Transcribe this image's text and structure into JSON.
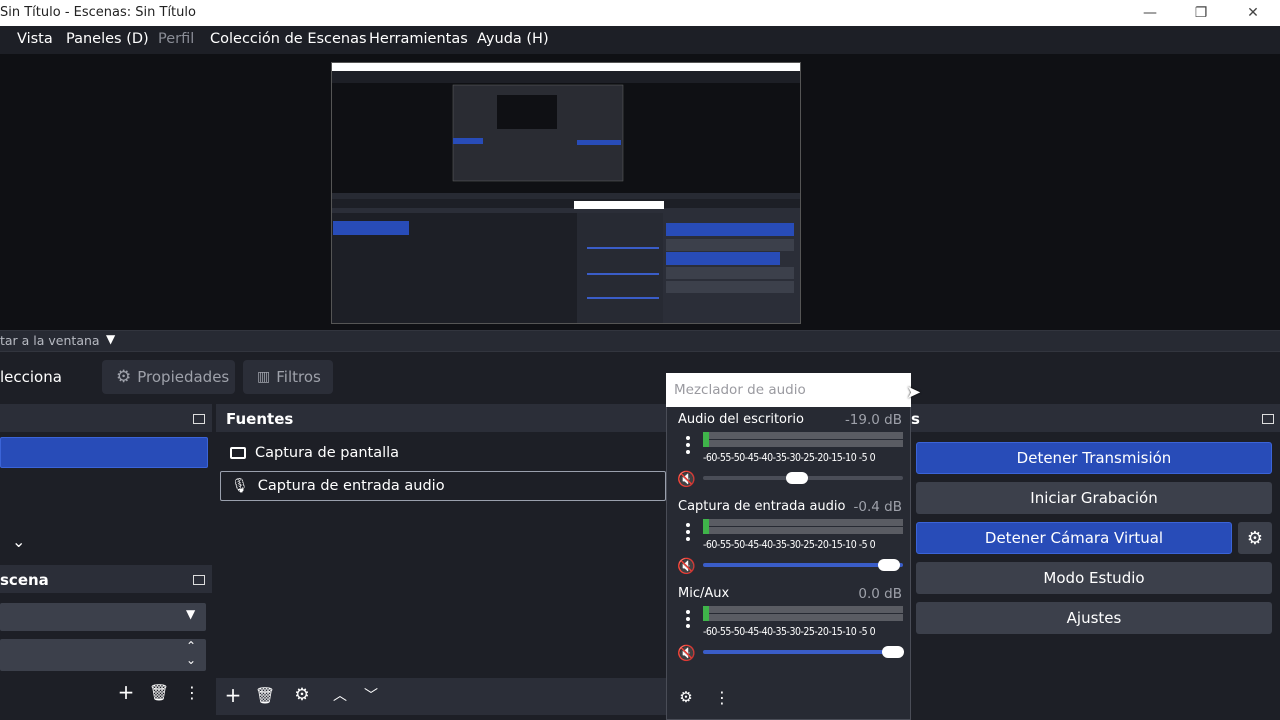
{
  "window": {
    "title": "Sin Título - Escenas: Sin Título",
    "minimize": "—",
    "maximize": "❐",
    "close": "✕"
  },
  "menu": {
    "items": [
      "Vista",
      "Paneles (D)",
      "Perfil",
      "Colección de Escenas",
      "Herramientas",
      "Ayuda (H)"
    ]
  },
  "scalebar": {
    "text": "tar a la ventana"
  },
  "context": {
    "selection_label": "lecciona",
    "properties": "Propiedades",
    "filters": "Filtros"
  },
  "scene_transitions": {
    "label": "scena"
  },
  "sources": {
    "title": "Fuentes",
    "items": [
      {
        "label": "Captura de pantalla",
        "icon": "monitor-icon"
      },
      {
        "label": "Captura de entrada audio",
        "icon": "microphone-icon"
      }
    ]
  },
  "mixer": {
    "title": "Mezclador de audio",
    "ticks": "-60-55-50-45-40-35-30-25-20-15-10 -5  0",
    "channels": [
      {
        "name": "Audio del escritorio",
        "db": "-19.0 dB",
        "volume": 0.47,
        "muted": true
      },
      {
        "name": "Captura de entrada audio",
        "db": "-0.4 dB",
        "volume": 0.93,
        "muted": true
      },
      {
        "name": "Mic/Aux",
        "db": "0.0 dB",
        "volume": 0.95,
        "muted": true
      }
    ]
  },
  "controls": {
    "header_fragment": "s",
    "stop_stream": "Detener Transmisión",
    "start_record": "Iniciar Grabación",
    "stop_virtual_cam": "Detener Cámara Virtual",
    "studio_mode": "Modo Estudio",
    "settings": "Ajustes"
  },
  "colors": {
    "active_button": "#284cb8",
    "background": "#1d1f26",
    "dock": "#2b2e38",
    "meter_green": "#3fb44a",
    "mute_red": "#c8233b"
  }
}
